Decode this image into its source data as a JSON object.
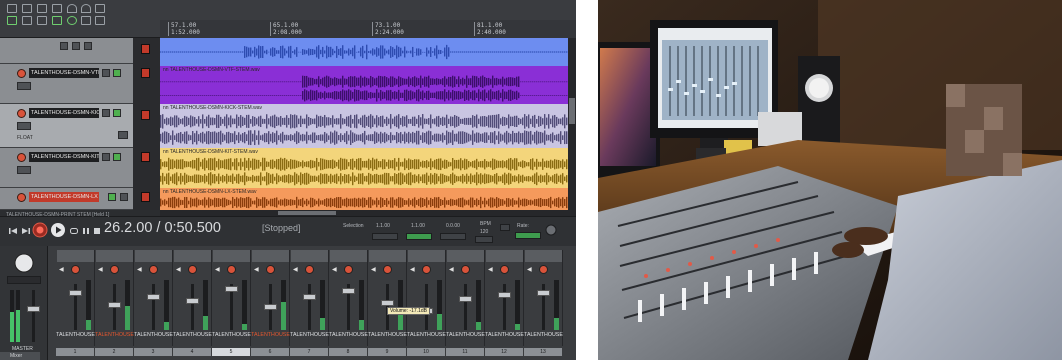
{
  "daw": {
    "ruler": [
      {
        "bar": "57.1.00",
        "time": "1:52.000"
      },
      {
        "bar": "65.1.00",
        "time": "2:08.000"
      },
      {
        "bar": "73.1.00",
        "time": "2:24.000"
      },
      {
        "bar": "81.1.00",
        "time": "2:40.000"
      }
    ],
    "tracks": [
      {
        "name": "",
        "item": "",
        "color": "#6d8df0",
        "wave": "#2d4bb0"
      },
      {
        "name": "TALENTHOUSE-DSMN-VTF",
        "item": "nn TALENTHOUSE-DSMN-VTF-STEM.wav",
        "color": "#8a2fd6",
        "wave": "#3c0f6a"
      },
      {
        "name": "TALENTHOUSE-DSMN-KIC",
        "item": "nn TALENTHOUSE-DSMN-KICK-STEM.wav",
        "color": "#c9c5e2",
        "wave": "#514c78",
        "mode": "FLOAT"
      },
      {
        "name": "TALENTHOUSE-DSMN-KIT",
        "item": "nn TALENTHOUSE-DSMN-KIT-STEM.wav",
        "color": "#f3d57b",
        "wave": "#8a6b12"
      },
      {
        "name": "TALENTHOUSE-DSMN-LX",
        "item": "nn TALENTHOUSE-DSMN-LX-STEM.wav",
        "color": "#f59a5c",
        "wave": "#8a3d0c"
      }
    ],
    "transport": {
      "project": "TALENTHOUSE-DSMN-PRINT STEM [Held 1]",
      "position": "26.2.00 / 0:50.500",
      "status": "[Stopped]",
      "selection_label": "Selection",
      "sel_start": "1.1.00",
      "sel_end": "1.1.00",
      "sel_length": "0.0.00",
      "bpm_label": "BPM",
      "bpm": "120",
      "rate_label": "Rate:"
    },
    "mixer": {
      "master_label": "MASTER",
      "tab_label": "Mixer",
      "tooltip": "Volume: -17.1dB",
      "strips": [
        {
          "name": "TALENTHOUSE",
          "num": "1",
          "hl": false
        },
        {
          "name": "TALENTHOUSE",
          "num": "2",
          "hl": true
        },
        {
          "name": "TALENTHOUSE",
          "num": "3",
          "hl": false
        },
        {
          "name": "TALENTHOUSE",
          "num": "4",
          "hl": false
        },
        {
          "name": "TALENTHOUSE",
          "num": "5",
          "hl": false
        },
        {
          "name": "TALENTHOUSE",
          "num": "6",
          "hl": true
        },
        {
          "name": "TALENTHOUSE",
          "num": "7",
          "hl": false
        },
        {
          "name": "TALENTHOUSE",
          "num": "8",
          "hl": false
        },
        {
          "name": "TALENTHOUSE",
          "num": "9",
          "hl": false
        },
        {
          "name": "TALENTHOUSE",
          "num": "10",
          "hl": false
        },
        {
          "name": "TALENTHOUSE",
          "num": "11",
          "hl": false
        },
        {
          "name": "TALENTHOUSE",
          "num": "12",
          "hl": false
        },
        {
          "name": "TALENTHOUSE",
          "num": "13",
          "hl": false
        }
      ]
    }
  }
}
